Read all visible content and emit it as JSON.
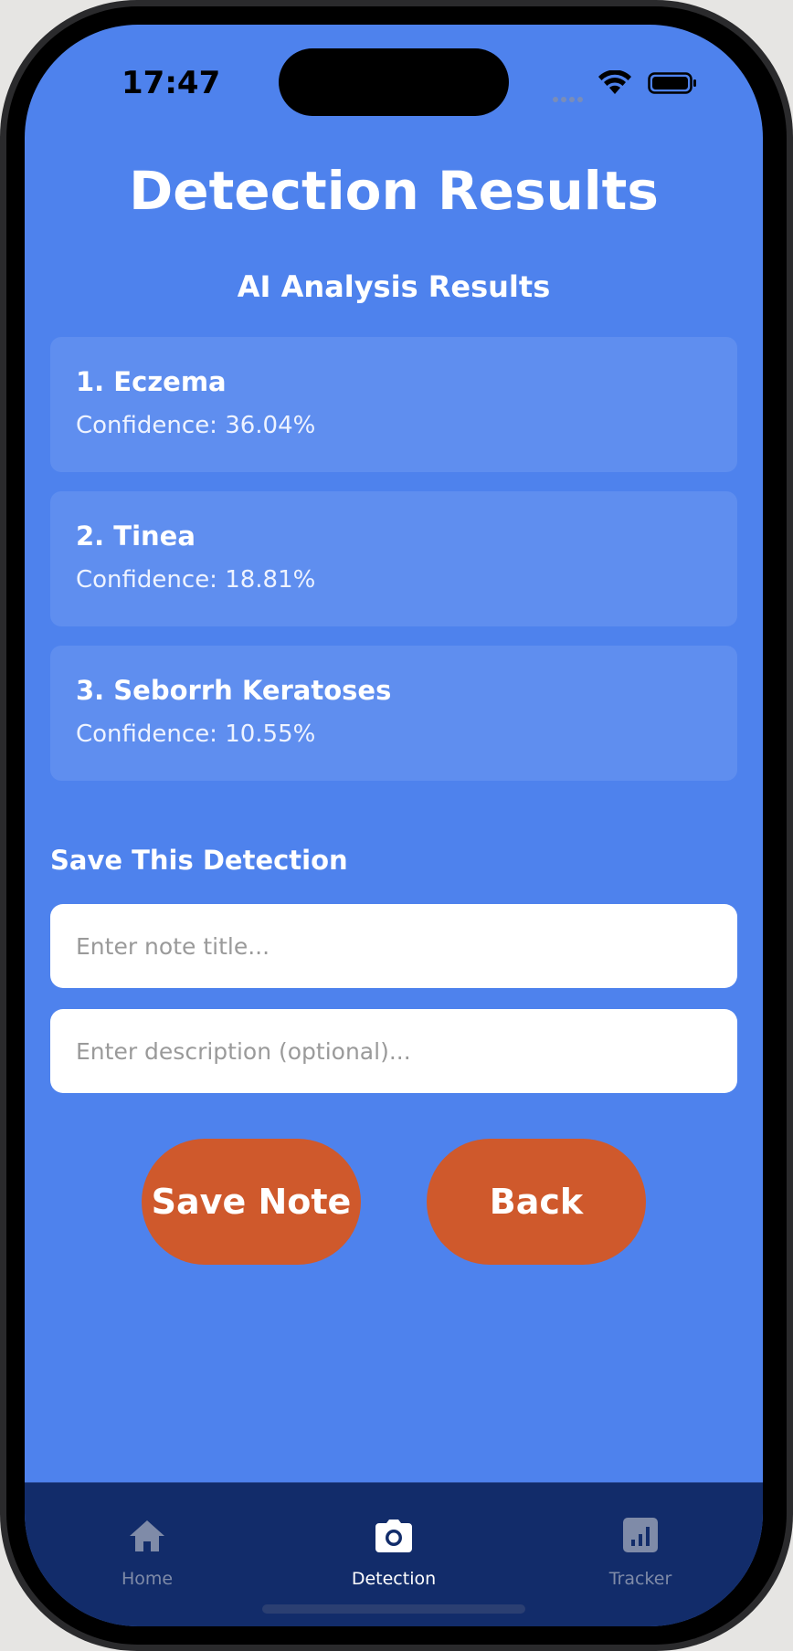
{
  "status_bar": {
    "time": "17:47"
  },
  "page": {
    "title": "Detection Results",
    "subtitle": "AI Analysis Results"
  },
  "results": [
    {
      "name": "1. Eczema",
      "confidence": "Confidence: 36.04%"
    },
    {
      "name": "2. Tinea",
      "confidence": "Confidence: 18.81%"
    },
    {
      "name": "3. Seborrh Keratoses",
      "confidence": "Confidence: 10.55%"
    }
  ],
  "save_form": {
    "label": "Save This Detection",
    "title_value": "",
    "title_placeholder": "Enter note title...",
    "description_value": "",
    "description_placeholder": "Enter description (optional)..."
  },
  "buttons": {
    "save_label": "Save Note",
    "back_label": "Back"
  },
  "tabbar": {
    "items": [
      {
        "label": "Home",
        "icon": "home-icon",
        "active": false
      },
      {
        "label": "Detection",
        "icon": "camera-icon",
        "active": true
      },
      {
        "label": "Tracker",
        "icon": "chart-icon",
        "active": false
      }
    ]
  },
  "colors": {
    "background": "#4e82ed",
    "card": "#5f8eef",
    "button": "#cf592c",
    "tabbar": "#122c6a",
    "tab_inactive": "#7f8ba8",
    "tab_active": "#ffffff"
  }
}
